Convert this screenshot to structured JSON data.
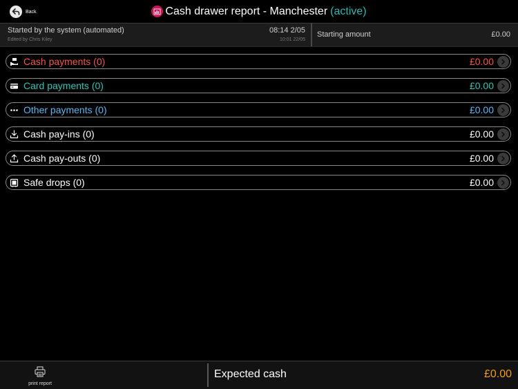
{
  "header": {
    "back_label": "Back",
    "title": "Cash drawer report - Manchester",
    "status": "(active)",
    "title_icon": "report-chart-icon",
    "status_color": "#2ab8b0",
    "title_icon_color": "#c2185b"
  },
  "info": {
    "started_by": "Started by the system (automated)",
    "edited_by": "Edited by Chris Kiley",
    "start_time": "08:14 2/05",
    "edit_time": "10:01 22/05",
    "starting_amount_label": "Starting amount",
    "starting_amount_value": "£0.00"
  },
  "rows": [
    {
      "label": "Cash payments (0)",
      "value": "£0.00",
      "color": "#f0574b",
      "icon": "cash-hand-icon"
    },
    {
      "label": "Card payments (0)",
      "value": "£0.00",
      "color": "#2ec4b6",
      "icon": "card-icon"
    },
    {
      "label": "Other payments (0)",
      "value": "£0.00",
      "color": "#5bb8f0",
      "icon": "more-dots-icon"
    },
    {
      "label": "Cash pay-ins (0)",
      "value": "£0.00",
      "color": "#ffffff",
      "icon": "download-icon"
    },
    {
      "label": "Cash pay-outs (0)",
      "value": "£0.00",
      "color": "#ffffff",
      "icon": "upload-icon"
    },
    {
      "label": "Safe drops (0)",
      "value": "£0.00",
      "color": "#ffffff",
      "icon": "safe-icon"
    }
  ],
  "footer": {
    "print_label": "print report",
    "expected_label": "Expected cash",
    "expected_value": "£0.00",
    "expected_color": "#f39a1e"
  }
}
